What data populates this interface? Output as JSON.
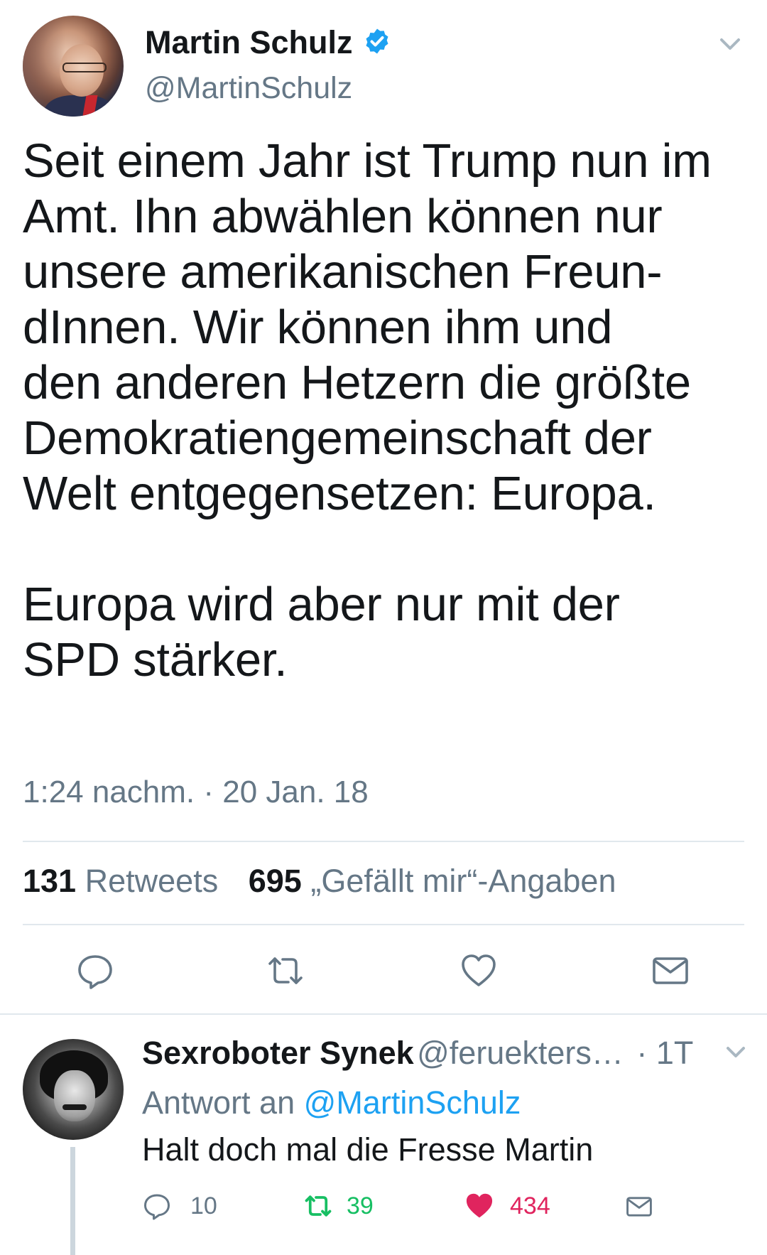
{
  "tweet": {
    "display_name": "Martin Schulz",
    "handle": "@MartinSchulz",
    "verified_icon": "verified-badge-icon",
    "text_paragraph_1": "Seit einem Jahr ist Trump nun im Amt. Ihn abwählen können nur unsere amerikanischen Freun-dInnen. Wir können ihm und den anderen Hetzern die größte Demokratiengemeinschaft der Welt entgegensetzen: Europa.",
    "text_lines_1": [
      "Seit einem Jahr ist Trump nun im",
      "Amt. Ihn abwählen können nur",
      "unsere amerikanischen Freun-",
      "dInnen. Wir können ihm und",
      "den anderen Hetzern die größte",
      "Demokratiengemeinschaft der",
      "Welt entgegensetzen: Europa."
    ],
    "text_lines_2": [
      "Europa wird aber nur mit der",
      "SPD stärker."
    ],
    "timestamp": "1:24 nachm. · 20 Jan. 18",
    "retweets_count": "131",
    "retweets_label": "Retweets",
    "likes_count": "695",
    "likes_label": "„Gefällt mir“-Angaben"
  },
  "reply": {
    "display_name": "Sexroboter Synek",
    "handle": "@feruekters…",
    "time_ago": "· 1T",
    "reply_to_prefix": "Antwort an",
    "reply_to_handle": "@MartinSchulz",
    "text": "Halt doch mal die Fresse Martin",
    "reply_count": "10",
    "retweet_count": "39",
    "like_count": "434"
  },
  "colors": {
    "text": "#14171a",
    "secondary": "#657786",
    "link": "#1da1f2",
    "retweet_green": "#17bf63",
    "like_red": "#e0245e",
    "divider": "#e1e8ed"
  }
}
